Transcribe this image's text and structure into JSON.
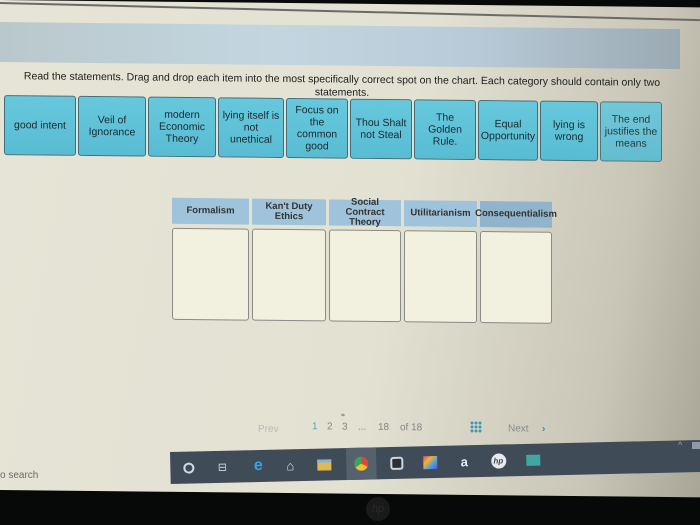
{
  "instructions": "Read the statements. Drag and drop each item into the most specifically correct spot on the chart. Each category should contain only two statements.",
  "statements": [
    {
      "label": "good intent"
    },
    {
      "label": "Veil of Ignorance"
    },
    {
      "label": "modern Economic Theory"
    },
    {
      "label": "lying itself is not unethical"
    },
    {
      "label": "Focus on the common good"
    },
    {
      "label": "Thou Shalt not Steal"
    },
    {
      "label": "The Golden Rule."
    },
    {
      "label": "Equal Opportunity"
    },
    {
      "label": "lying is wrong"
    },
    {
      "label": "The end justifies the means"
    }
  ],
  "categories": [
    {
      "label": "Formalism"
    },
    {
      "label": "Kan't Duty Ethics"
    },
    {
      "label": "Social Contract Theory"
    },
    {
      "label": "Utilitarianism"
    },
    {
      "label": "Consequentialism"
    }
  ],
  "pagination": {
    "prev_label": "Prev",
    "pages": [
      "1",
      "2",
      "3"
    ],
    "ellipsis": "...",
    "last_page": "18",
    "of_label": "of 18",
    "next_label": "Next",
    "next_arrow": "›",
    "current_page": "1"
  },
  "taskbar": {
    "search_text": "o search",
    "icons": [
      "cortana-icon",
      "task-view-icon",
      "edge-icon",
      "home-icon",
      "file-explorer-icon",
      "chrome-icon",
      "webcam-icon",
      "photos-icon",
      "amazon-icon",
      "hp-icon",
      "cloud-app-icon"
    ]
  }
}
